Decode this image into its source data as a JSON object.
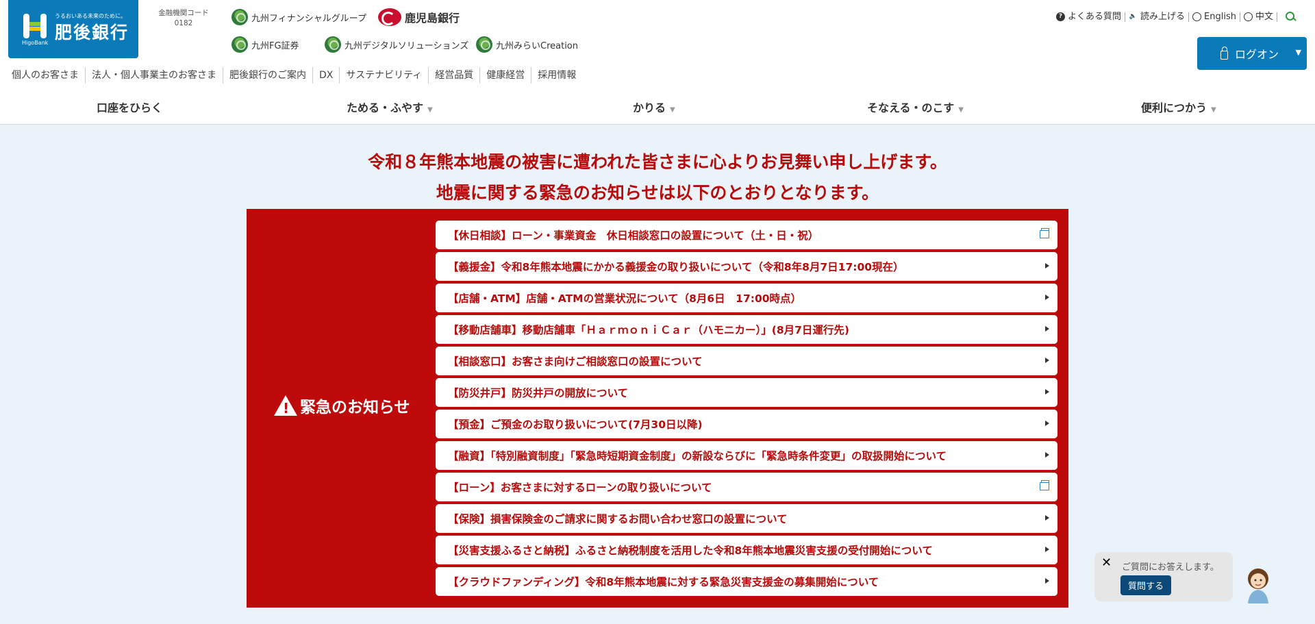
{
  "logo": {
    "tagline": "うるおいある未来のために。",
    "name": "肥後銀行",
    "en": "HigoBank"
  },
  "institution_code": {
    "label": "金融機関コード",
    "value": "0182"
  },
  "group_links": {
    "kyushu_fg": "九州フィナンシャルグループ",
    "kagoshima": "鹿児島銀行",
    "fg_securities": "九州FG証券",
    "digital": "九州デジタルソリューションズ",
    "mirai": "九州みらいCreation"
  },
  "utility": {
    "faq": "よくある質問",
    "read": "読み上げる",
    "english": "English",
    "chinese": "中文"
  },
  "logon": {
    "label": "ログオン"
  },
  "subnav": [
    "個人のお客さま",
    "法人・個人事業主のお客さま",
    "肥後銀行のご案内",
    "DX",
    "サステナビリティ",
    "経営品質",
    "健康経営",
    "採用情報"
  ],
  "mainnav": [
    "口座をひらく",
    "ためる・ふやす",
    "かりる",
    "そなえる・のこす",
    "便利につかう"
  ],
  "headline": {
    "line1": "令和８年熊本地震の被害に遭われた皆さまに心よりお見舞い申し上げます。",
    "line2": "地震に関する緊急のお知らせは以下のとおりとなります。"
  },
  "emergency": {
    "label": "緊急のお知らせ",
    "items": [
      "【休日相談】ローン・事業資金　休日相談窓口の設置について（土・日・祝）",
      "【義援金】令和8年熊本地震にかかる義援金の取り扱いについて（令和8年8月7日17:00現在）",
      "【店舗・ATM】店舗・ATMの営業状況について（8月6日　17:00時点）",
      "【移動店舗車】移動店舗車「ＨａｒｍｏｎｉＣａｒ（ハモニカー）」(8月7日運行先)",
      "【相談窓口】お客さま向けご相談窓口の設置について",
      "【防災井戸】防災井戸の開放について",
      "【預金】ご預金のお取り扱いについて(7月30日以降)",
      "【融資】「特別融資制度」「緊急時短期資金制度」の新設ならびに「緊急時条件変更」の取扱開始について",
      "【ローン】お客さまに対するローンの取り扱いについて",
      "【保険】損害保険金のご請求に関するお問い合わせ窓口の設置について",
      "【災害支援ふるさと納税】ふるさと納税制度を活用した令和8年熊本地震災害支援の受付開始について",
      "【クラウドファンディング】令和8年熊本地震に対する緊急災害支援金の募集開始について"
    ]
  },
  "chat": {
    "close": "✕",
    "prompt": "ご質問にお答えします。",
    "button": "質問する"
  }
}
